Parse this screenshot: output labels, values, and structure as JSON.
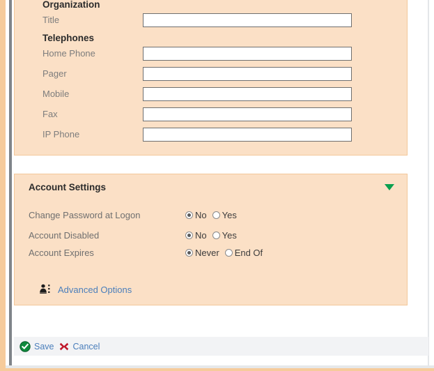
{
  "panels": {
    "contact": {
      "sections": [
        {
          "title": "Organization"
        },
        {
          "title": "Telephones"
        }
      ],
      "fields": [
        {
          "label": "Title",
          "value": "",
          "placeholder": ""
        },
        {
          "label": "Home Phone",
          "value": "",
          "placeholder": ""
        },
        {
          "label": "Pager",
          "value": "",
          "placeholder": ""
        },
        {
          "label": "Mobile",
          "value": "",
          "placeholder": ""
        },
        {
          "label": "Fax",
          "value": "",
          "placeholder": ""
        },
        {
          "label": "IP Phone",
          "value": "",
          "placeholder": ""
        }
      ]
    },
    "account": {
      "title": "Account Settings",
      "collapse_icon": "triangle-down-icon",
      "rows": [
        {
          "label": "Change Password at Logon",
          "options": [
            {
              "text": "No",
              "checked": true
            },
            {
              "text": "Yes",
              "checked": false
            }
          ]
        },
        {
          "label": "Account Disabled",
          "options": [
            {
              "text": "No",
              "checked": true
            },
            {
              "text": "Yes",
              "checked": false
            }
          ]
        },
        {
          "label": "Account Expires",
          "options": [
            {
              "text": "Never",
              "checked": true
            },
            {
              "text": "End Of",
              "checked": false
            }
          ]
        }
      ],
      "advanced": {
        "icon": "user-options-icon",
        "label": "Advanced Options"
      }
    }
  },
  "save_bar": {
    "save": {
      "icon": "green-check-circle-icon",
      "label": "Save"
    },
    "cancel": {
      "icon": "red-x-icon",
      "label": "Cancel"
    }
  },
  "colors": {
    "panel_bg": "#FBE0C6",
    "panel_border": "#F3C79A",
    "accent_green": "#0AA04F",
    "accent_red": "#C0182B",
    "link_blue": "#4A7EBB",
    "save_bar_bg": "#F2F3F5",
    "rail_orange": "#F6CB9B"
  }
}
